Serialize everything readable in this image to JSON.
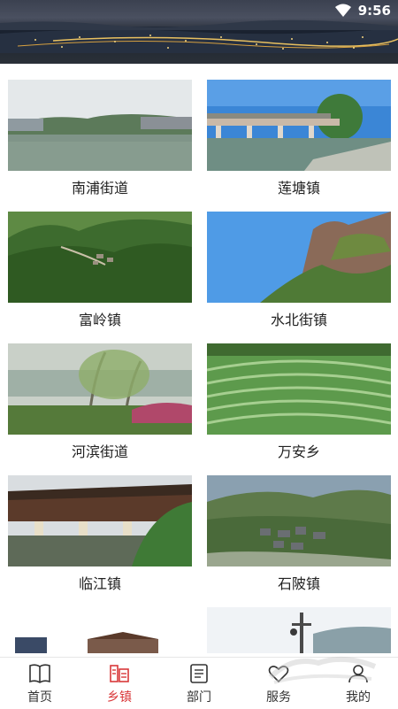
{
  "status_bar": {
    "time": "9:56",
    "wifi_icon": "wifi-icon"
  },
  "towns": [
    {
      "name": "南浦街道",
      "scene": "lake-town"
    },
    {
      "name": "莲塘镇",
      "scene": "bridge-river"
    },
    {
      "name": "富岭镇",
      "scene": "green-valley"
    },
    {
      "name": "水北街镇",
      "scene": "rock-cliff"
    },
    {
      "name": "河滨街道",
      "scene": "riverside-willows"
    },
    {
      "name": "万安乡",
      "scene": "terraced-fields"
    },
    {
      "name": "临江镇",
      "scene": "covered-bridge"
    },
    {
      "name": "石陂镇",
      "scene": "mountain-village"
    }
  ],
  "tabbar": {
    "active": "乡镇",
    "items": [
      {
        "label": "首页",
        "icon": "book-icon"
      },
      {
        "label": "乡镇",
        "icon": "town-icon"
      },
      {
        "label": "部门",
        "icon": "document-icon"
      },
      {
        "label": "服务",
        "icon": "heart-icon"
      },
      {
        "label": "我的",
        "icon": "user-icon"
      }
    ]
  },
  "colors": {
    "accent": "#d9383a",
    "text": "#222222",
    "tab_text": "#333333"
  }
}
